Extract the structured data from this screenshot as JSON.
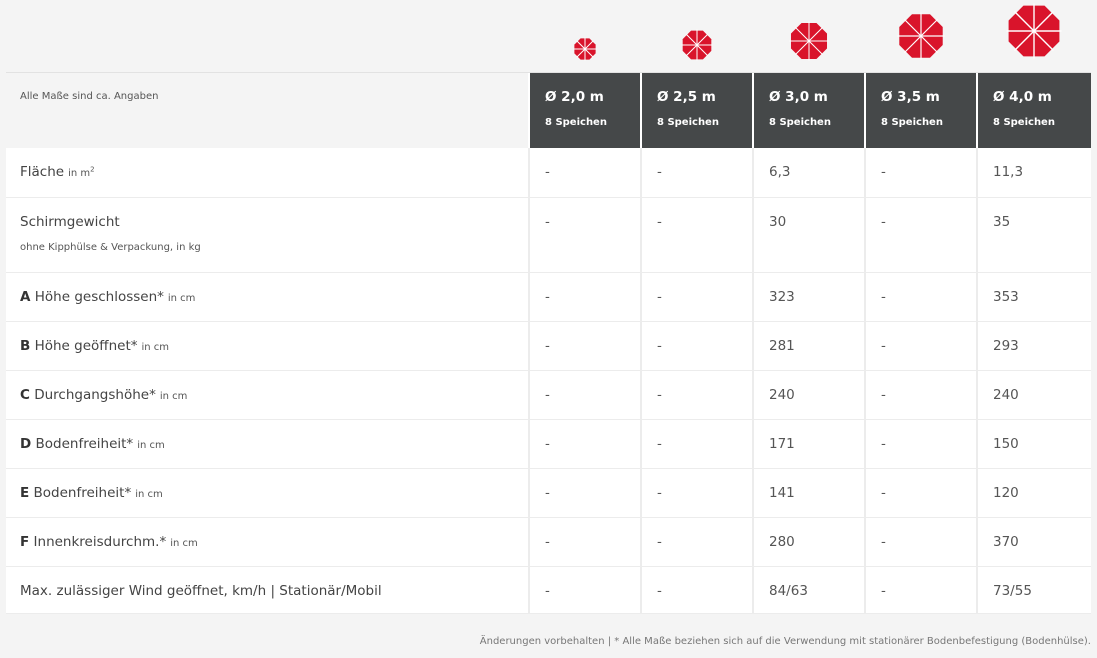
{
  "note_label": "Alle Maße sind ca. Angaben",
  "accent_color": "#d9142b",
  "header_bg_color": "#454849",
  "columns": [
    {
      "size": "Ø 2,0 m",
      "spokes": "8 Speichen",
      "icon": "umbrella-top-icon"
    },
    {
      "size": "Ø 2,5 m",
      "spokes": "8 Speichen",
      "icon": "umbrella-top-icon"
    },
    {
      "size": "Ø 3,0 m",
      "spokes": "8 Speichen",
      "icon": "umbrella-top-icon"
    },
    {
      "size": "Ø 3,5 m",
      "spokes": "8 Speichen",
      "icon": "umbrella-top-icon"
    },
    {
      "size": "Ø 4,0 m",
      "spokes": "8 Speichen",
      "icon": "umbrella-top-icon"
    }
  ],
  "rows": [
    {
      "label": "Fläche",
      "unit": "in m",
      "unit_sup": "2",
      "values": [
        "-",
        "-",
        "6,3",
        "-",
        "11,3"
      ]
    },
    {
      "label": "Schirmgewicht",
      "sub": "ohne Kipphülse & Verpackung, in kg",
      "values": [
        "-",
        "-",
        "30",
        "-",
        "35"
      ]
    },
    {
      "letter": "A",
      "label": "Höhe geschlossen*",
      "unit": "in cm",
      "values": [
        "-",
        "-",
        "323",
        "-",
        "353"
      ]
    },
    {
      "letter": "B",
      "label": "Höhe geöffnet*",
      "unit": "in cm",
      "values": [
        "-",
        "-",
        "281",
        "-",
        "293"
      ]
    },
    {
      "letter": "C",
      "label": "Durchgangshöhe*",
      "unit": "in cm",
      "values": [
        "-",
        "-",
        "240",
        "-",
        "240"
      ]
    },
    {
      "letter": "D",
      "label": "Bodenfreiheit*",
      "unit": "in cm",
      "values": [
        "-",
        "-",
        "171",
        "-",
        "150"
      ]
    },
    {
      "letter": "E",
      "label": "Bodenfreiheit*",
      "unit": "in cm",
      "values": [
        "-",
        "-",
        "141",
        "-",
        "120"
      ]
    },
    {
      "letter": "F",
      "label": "Innenkreisdurchm.*",
      "unit": "in cm",
      "values": [
        "-",
        "-",
        "280",
        "-",
        "370"
      ]
    },
    {
      "label": "Max. zulässiger Wind geöffnet, km/h | Stationär/Mobil",
      "values": [
        "-",
        "-",
        "84/63",
        "-",
        "73/55"
      ]
    }
  ],
  "footer": "Änderungen vorbehalten | * Alle Maße beziehen sich auf die Verwendung mit stationärer Bodenbefestigung (Bodenhülse)."
}
